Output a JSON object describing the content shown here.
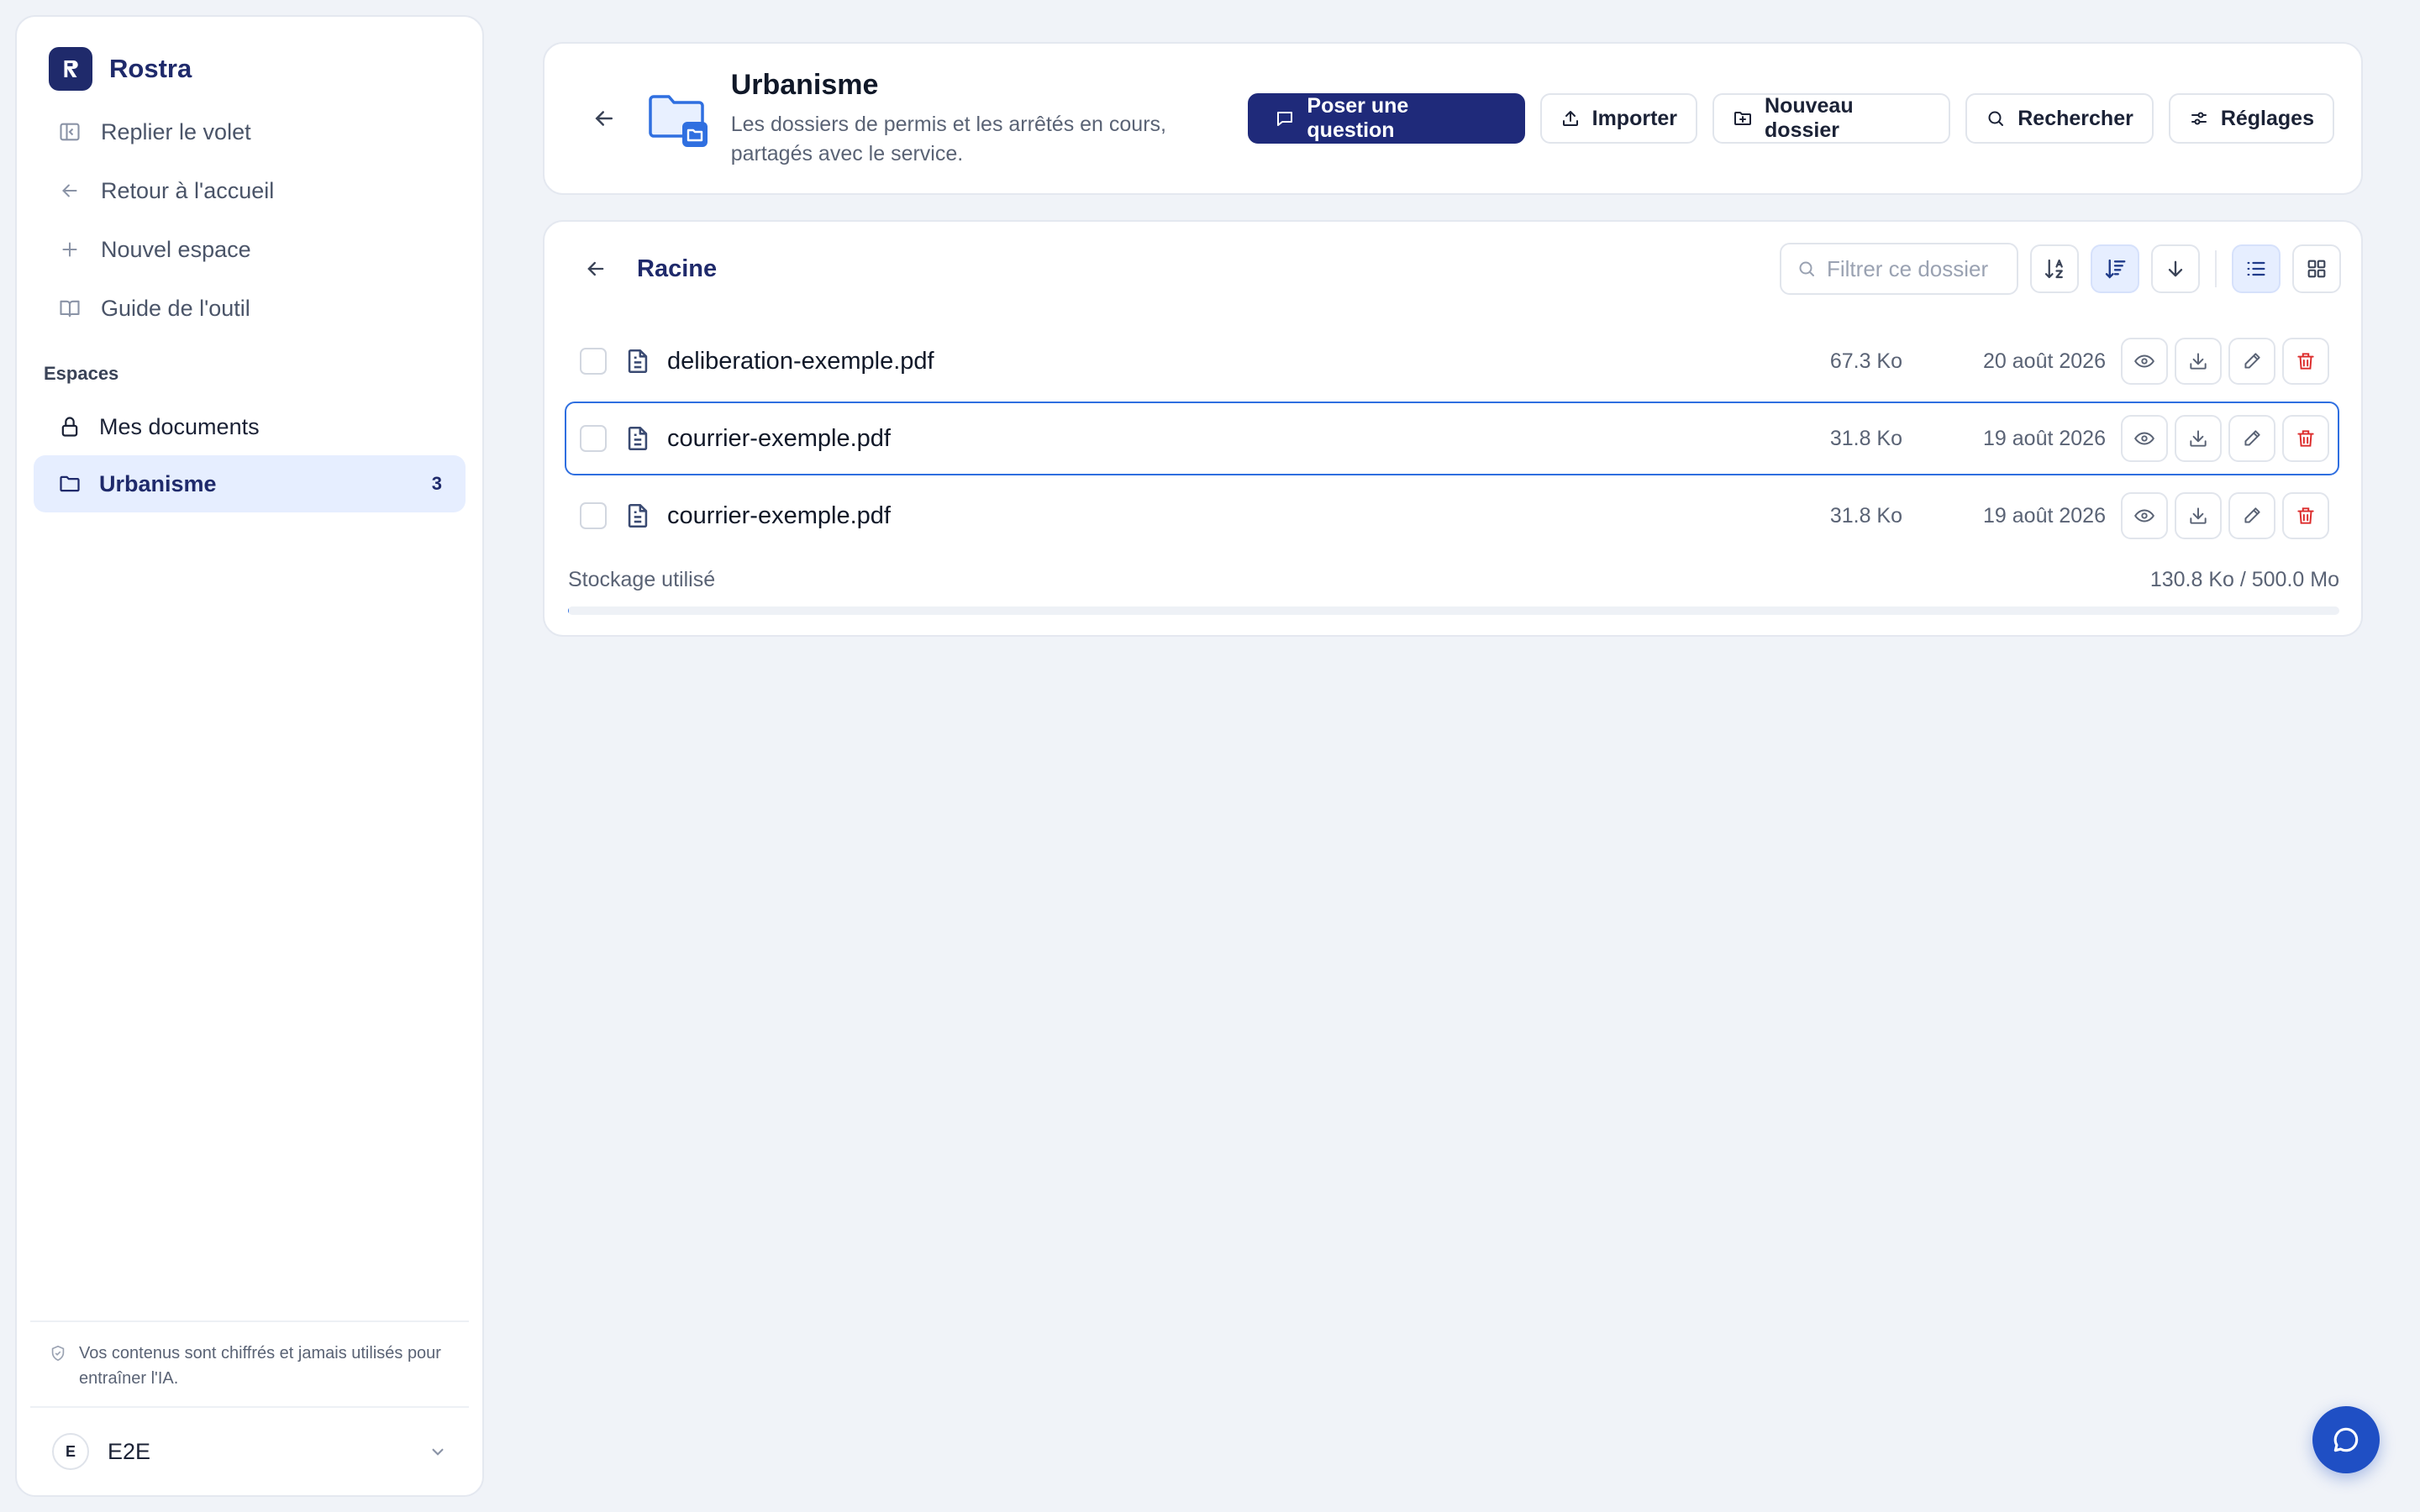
{
  "app": {
    "name": "Rostra"
  },
  "sidebar": {
    "nav": [
      {
        "label": "Replier le volet",
        "icon": "collapse-panel-icon"
      },
      {
        "label": "Retour à l'accueil",
        "icon": "arrow-left-icon"
      },
      {
        "label": "Nouvel espace",
        "icon": "plus-icon"
      },
      {
        "label": "Guide de l'outil",
        "icon": "book-icon"
      }
    ],
    "spaces_label": "Espaces",
    "spaces": [
      {
        "label": "Mes documents",
        "icon": "lock-icon",
        "count": ""
      },
      {
        "label": "Urbanisme",
        "icon": "folder-icon",
        "count": "3",
        "active": true
      }
    ],
    "privacy_note": "Vos contenus sont chiffrés et jamais utilisés pour entraîner l'IA.",
    "user": {
      "initial": "E",
      "name": "E2E"
    }
  },
  "header": {
    "title": "Urbanisme",
    "subtitle": "Les dossiers de permis et les arrêtés en cours, partagés avec le service.",
    "actions": {
      "ask": "Poser une question",
      "import": "Importer",
      "new_folder": "Nouveau dossier",
      "search": "Rechercher",
      "settings": "Réglages"
    }
  },
  "files": {
    "breadcrumb": "Racine",
    "filter_placeholder": "Filtrer ce dossier",
    "items": [
      {
        "name": "deliberation-exemple.pdf",
        "size": "67.3 Ko",
        "date": "20 août 2026",
        "selected": false
      },
      {
        "name": "courrier-exemple.pdf",
        "size": "31.8 Ko",
        "date": "19 août 2026",
        "selected": true
      },
      {
        "name": "courrier-exemple.pdf",
        "size": "31.8 Ko",
        "date": "19 août 2026",
        "selected": false
      }
    ],
    "storage_label": "Stockage utilisé",
    "storage_value": "130.8 Ko / 500.0 Mo",
    "storage_fraction": 0.0003
  },
  "colors": {
    "accent": "#1f2a7a",
    "selection": "#2f6fe0",
    "danger": "#dc2b2b"
  }
}
